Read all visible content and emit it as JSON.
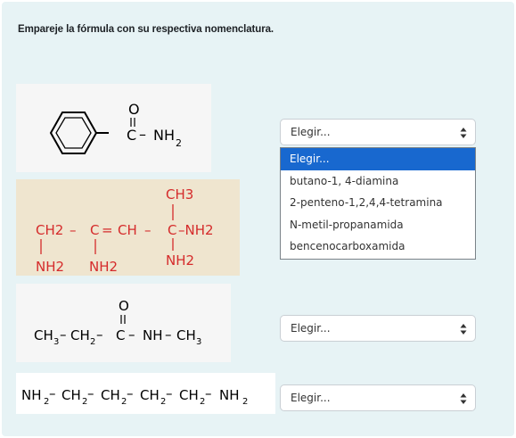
{
  "question": "Empareje la fórmula con su respectiva nomenclatura.",
  "formulas": {
    "f1": {
      "o": "O",
      "c": "C",
      "dash": "–",
      "nh2": "NH",
      "sub2": "2"
    },
    "f2": {
      "ch3": "CH3",
      "ch2": "CH2",
      "dash1": "–",
      "c1": "C",
      "eq": "=",
      "ch": "CH",
      "dash2": "–",
      "c2": "C",
      "nh2_right": "–NH2",
      "nh2_a": "NH2",
      "nh2_b": "NH2",
      "nh2_c": "NH2",
      "text_color": "#d52b2b",
      "bg_color": "#efe5cf"
    },
    "f3": {
      "o": "O",
      "ch3_left": "CH",
      "sub3a": "3",
      "dash1": "–",
      "ch2": "CH",
      "sub2": "2",
      "dash2": "–",
      "c": "C",
      "dash3": "–",
      "nh": "NH",
      "dash4": "–",
      "ch3_right": "CH",
      "sub3b": "3"
    },
    "f4": {
      "nh2_left": "NH",
      "sub_a": "2",
      "d1": "–",
      "ch2_1": "CH",
      "sub_b": "2",
      "d2": "–",
      "ch2_2": "CH",
      "sub_c": "2",
      "d3": "–",
      "ch2_3": "CH",
      "sub_d": "2",
      "d4": "–",
      "ch2_4": "CH",
      "sub_e": "2",
      "d5": "–",
      "nh2_right": "NH",
      "sub_f": "2"
    }
  },
  "selects": [
    {
      "value": "Elegir..."
    },
    {
      "value": "Elegir..."
    },
    {
      "value": "Elegir..."
    }
  ],
  "dropdown_options": [
    {
      "label": "Elegir...",
      "selected": true
    },
    {
      "label": "butano-1, 4-diamina",
      "selected": false
    },
    {
      "label": "2-penteno-1,2,4,4-tetramina",
      "selected": false
    },
    {
      "label": "N-metil-propanamida",
      "selected": false
    },
    {
      "label": "bencenocarboxamida",
      "selected": false
    }
  ],
  "colors": {
    "panel_bg": "#e7f3f5",
    "highlight": "#1868cf"
  }
}
